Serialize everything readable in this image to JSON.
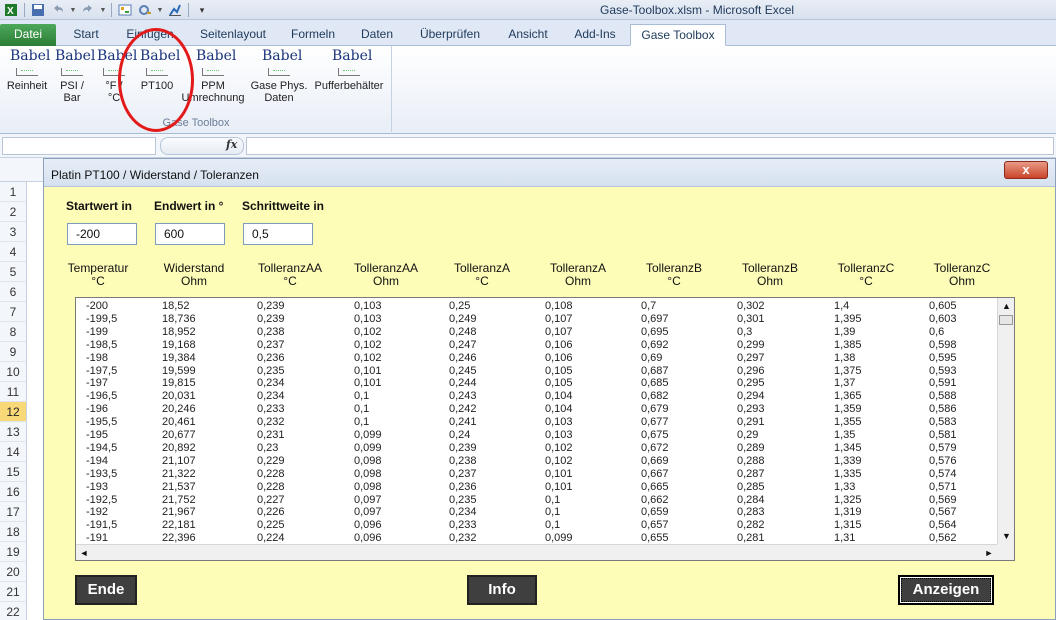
{
  "window": {
    "title": "Gase-Toolbox.xlsm  -  Microsoft Excel"
  },
  "qat": {
    "icons": [
      "excel-icon",
      "save-icon",
      "undo-icon",
      "redo-icon",
      "form-icon",
      "tools-icon",
      "chart-icon",
      "customize-icon"
    ]
  },
  "ribbon": {
    "tabs": [
      "Datei",
      "Start",
      "Einfügen",
      "Seitenlayout",
      "Formeln",
      "Daten",
      "Überprüfen",
      "Ansicht",
      "Add-Ins",
      "Gase Toolbox"
    ],
    "active_tab": "Gase Toolbox",
    "group_label": "Gase Toolbox",
    "icon_text": "Babel",
    "buttons": [
      {
        "label1": "Reinheit",
        "label2": ""
      },
      {
        "label1": "PSI /",
        "label2": "Bar"
      },
      {
        "label1": "°F /",
        "label2": "°C"
      },
      {
        "label1": "PT100",
        "label2": ""
      },
      {
        "label1": "PPM",
        "label2": "Umrechnung"
      },
      {
        "label1": "Gase Phys.",
        "label2": "Daten"
      },
      {
        "label1": "Pufferbehälter",
        "label2": ""
      }
    ],
    "highlight_color": "#e31a1a"
  },
  "formula_bar": {
    "fx": "fx",
    "name_box": "",
    "content": ""
  },
  "sheet": {
    "rows": [
      "1",
      "2",
      "3",
      "4",
      "5",
      "6",
      "7",
      "8",
      "9",
      "10",
      "11",
      "12",
      "13",
      "14",
      "15",
      "16",
      "17",
      "18",
      "19",
      "20",
      "21",
      "22"
    ],
    "selected_row": "12"
  },
  "dialog": {
    "title": "Platin PT100 / Widerstand / Toleranzen",
    "close_label": "x",
    "fields": {
      "start_label": "Startwert in",
      "end_label": "Endwert in °",
      "step_label": "Schrittweite in",
      "start_value": "-200",
      "end_value": "600",
      "step_value": "0,5"
    },
    "columns": [
      {
        "l1": "Temperatur",
        "l2": "°C"
      },
      {
        "l1": "Widerstand",
        "l2": "Ohm"
      },
      {
        "l1": "TolleranzAA",
        "l2": "°C"
      },
      {
        "l1": "TolleranzAA",
        "l2": "Ohm"
      },
      {
        "l1": "TolleranzA",
        "l2": "°C"
      },
      {
        "l1": "TolleranzA",
        "l2": "Ohm"
      },
      {
        "l1": "TolleranzB",
        "l2": "°C"
      },
      {
        "l1": "TolleranzB",
        "l2": "Ohm"
      },
      {
        "l1": "TolleranzC",
        "l2": "°C"
      },
      {
        "l1": "TolleranzC",
        "l2": "Ohm"
      }
    ],
    "rows": [
      [
        "-200",
        "18,52",
        "0,239",
        "0,103",
        "0,25",
        "0,108",
        "0,7",
        "0,302",
        "1,4",
        "0,605"
      ],
      [
        "-199,5",
        "18,736",
        "0,239",
        "0,103",
        "0,249",
        "0,107",
        "0,697",
        "0,301",
        "1,395",
        "0,603"
      ],
      [
        "-199",
        "18,952",
        "0,238",
        "0,102",
        "0,248",
        "0,107",
        "0,695",
        "0,3",
        "1,39",
        "0,6"
      ],
      [
        "-198,5",
        "19,168",
        "0,237",
        "0,102",
        "0,247",
        "0,106",
        "0,692",
        "0,299",
        "1,385",
        "0,598"
      ],
      [
        "-198",
        "19,384",
        "0,236",
        "0,102",
        "0,246",
        "0,106",
        "0,69",
        "0,297",
        "1,38",
        "0,595"
      ],
      [
        "-197,5",
        "19,599",
        "0,235",
        "0,101",
        "0,245",
        "0,105",
        "0,687",
        "0,296",
        "1,375",
        "0,593"
      ],
      [
        "-197",
        "19,815",
        "0,234",
        "0,101",
        "0,244",
        "0,105",
        "0,685",
        "0,295",
        "1,37",
        "0,591"
      ],
      [
        "-196,5",
        "20,031",
        "0,234",
        "0,1",
        "0,243",
        "0,104",
        "0,682",
        "0,294",
        "1,365",
        "0,588"
      ],
      [
        "-196",
        "20,246",
        "0,233",
        "0,1",
        "0,242",
        "0,104",
        "0,679",
        "0,293",
        "1,359",
        "0,586"
      ],
      [
        "-195,5",
        "20,461",
        "0,232",
        "0,1",
        "0,241",
        "0,103",
        "0,677",
        "0,291",
        "1,355",
        "0,583"
      ],
      [
        "-195",
        "20,677",
        "0,231",
        "0,099",
        "0,24",
        "0,103",
        "0,675",
        "0,29",
        "1,35",
        "0,581"
      ],
      [
        "-194,5",
        "20,892",
        "0,23",
        "0,099",
        "0,239",
        "0,102",
        "0,672",
        "0,289",
        "1,345",
        "0,579"
      ],
      [
        "-194",
        "21,107",
        "0,229",
        "0,098",
        "0,238",
        "0,102",
        "0,669",
        "0,288",
        "1,339",
        "0,576"
      ],
      [
        "-193,5",
        "21,322",
        "0,228",
        "0,098",
        "0,237",
        "0,101",
        "0,667",
        "0,287",
        "1,335",
        "0,574"
      ],
      [
        "-193",
        "21,537",
        "0,228",
        "0,098",
        "0,236",
        "0,101",
        "0,665",
        "0,285",
        "1,33",
        "0,571"
      ],
      [
        "-192,5",
        "21,752",
        "0,227",
        "0,097",
        "0,235",
        "0,1",
        "0,662",
        "0,284",
        "1,325",
        "0,569"
      ],
      [
        "-192",
        "21,967",
        "0,226",
        "0,097",
        "0,234",
        "0,1",
        "0,659",
        "0,283",
        "1,319",
        "0,567"
      ],
      [
        "-191,5",
        "22,181",
        "0,225",
        "0,096",
        "0,233",
        "0,1",
        "0,657",
        "0,282",
        "1,315",
        "0,564"
      ],
      [
        "-191",
        "22,396",
        "0,224",
        "0,096",
        "0,232",
        "0,099",
        "0,655",
        "0,281",
        "1,31",
        "0,562"
      ]
    ],
    "scroll_up": "▲",
    "scroll_down": "▼",
    "scroll_left": "◄",
    "scroll_right": "►",
    "buttons": {
      "end": "Ende",
      "info": "Info",
      "show": "Anzeigen"
    }
  }
}
